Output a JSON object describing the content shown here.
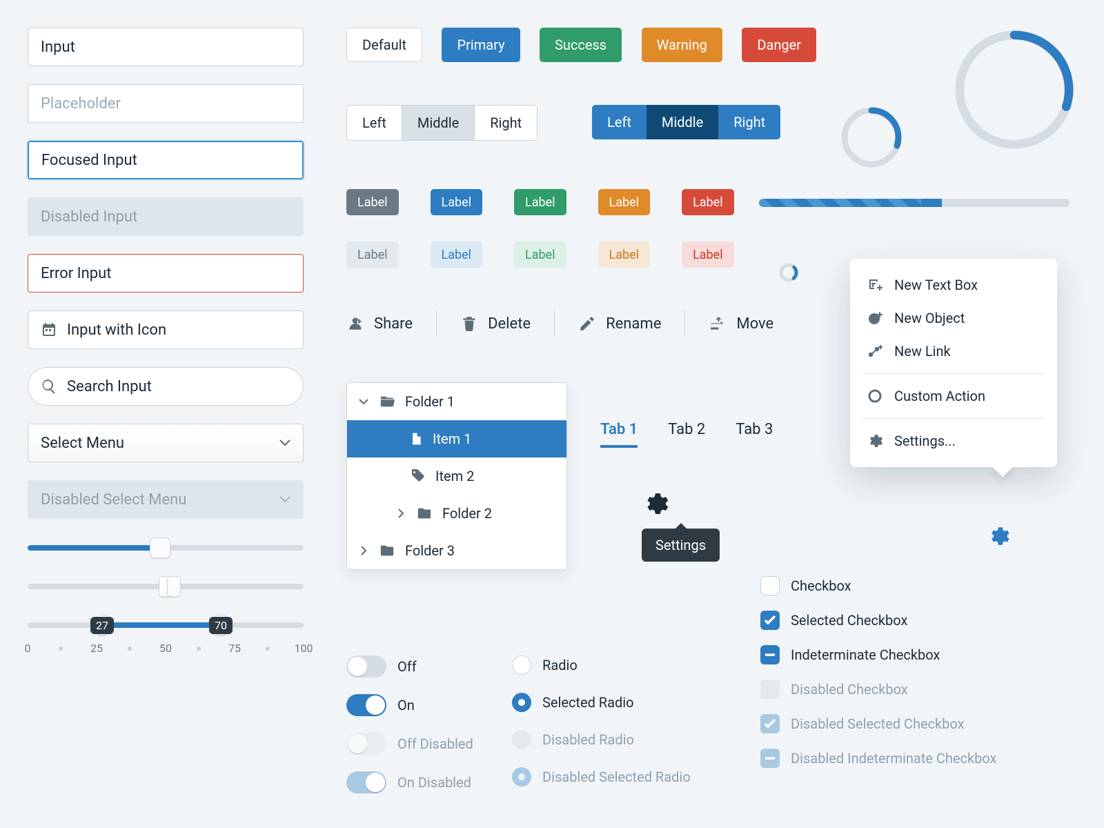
{
  "inputs": {
    "value": "Input",
    "placeholder": "Placeholder",
    "focused": "Focused Input",
    "disabled": "Disabled Input",
    "error": "Error Input",
    "with_icon": "Input with Icon",
    "search": "Search Input",
    "select": "Select Menu",
    "select_disabled": "Disabled Select Menu"
  },
  "sliders": {
    "single_value": 48,
    "double_value": 50,
    "ranged_low": 27,
    "ranged_high": 70,
    "scale": [
      "0",
      "25",
      "50",
      "75",
      "100"
    ]
  },
  "buttons": {
    "default": "Default",
    "primary": "Primary",
    "success": "Success",
    "warning": "Warning",
    "danger": "Danger"
  },
  "segment_light": {
    "left": "Left",
    "middle": "Middle",
    "right": "Right",
    "active": "middle"
  },
  "segment_blue": {
    "left": "Left",
    "middle": "Middle",
    "right": "Right",
    "active": "middle"
  },
  "labels": {
    "solid": [
      "Label",
      "Label",
      "Label",
      "Label",
      "Label"
    ],
    "soft": [
      "Label",
      "Label",
      "Label",
      "Label",
      "Label"
    ]
  },
  "toolbar": {
    "share": "Share",
    "delete": "Delete",
    "rename": "Rename",
    "move": "Move"
  },
  "tree": {
    "folder1": "Folder 1",
    "item1": "Item 1",
    "item2": "Item 2",
    "folder2": "Folder 2",
    "folder3": "Folder 3"
  },
  "tabs": [
    "Tab 1",
    "Tab 2",
    "Tab 3"
  ],
  "tooltip": "Settings",
  "progress_rings": {
    "small_pct": 30,
    "large_pct": 30
  },
  "progress_bar_pct": 54,
  "popover": {
    "new_text_box": "New Text Box",
    "new_object": "New Object",
    "new_link": "New Link",
    "custom_action": "Custom Action",
    "settings": "Settings..."
  },
  "toggles": {
    "off": "Off",
    "on": "On",
    "off_disabled": "Off Disabled",
    "on_disabled": "On Disabled"
  },
  "radios": {
    "radio": "Radio",
    "selected": "Selected Radio",
    "disabled": "Disabled Radio",
    "disabled_selected": "Disabled Selected Radio"
  },
  "checks": {
    "checkbox": "Checkbox",
    "selected": "Selected Checkbox",
    "indeterminate": "Indeterminate Checkbox",
    "disabled": "Disabled Checkbox",
    "disabled_selected": "Disabled Selected Checkbox",
    "disabled_indeterminate": "Disabled Indeterminate Checkbox"
  }
}
